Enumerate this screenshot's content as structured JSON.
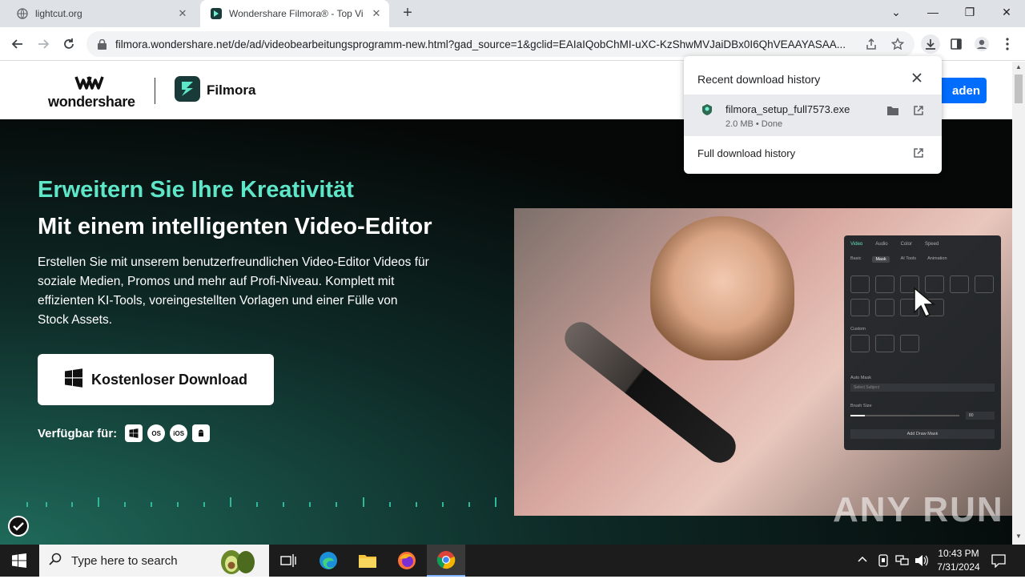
{
  "browser": {
    "tabs": [
      {
        "title": "lightcut.org",
        "close": "✕"
      },
      {
        "title": "Wondershare Filmora® - Top Vi",
        "close": "✕"
      }
    ],
    "new_tab": "+",
    "window_controls": {
      "dropdown": "⌄",
      "minimize": "—",
      "restore": "❐",
      "close": "✕"
    },
    "url": "filmora.wondershare.net/de/ad/videobearbeitungsprogramm-new.html?gad_source=1&gclid=EAIaIQobChMI-uXC-KzShwMVJaiDBx0I6QhVEAAYASAA...",
    "accent": "#1a73e8"
  },
  "site": {
    "brand": "wondershare",
    "product": "Filmora",
    "header_cta": "aden"
  },
  "hero": {
    "headline": "Erweitern Sie Ihre Kreativität",
    "subheadline": "Mit einem intelligenten Video-Editor",
    "description": "Erstellen Sie mit unserem benutzerfreundlichen Video-Editor Videos für soziale Medien, Promos und mehr auf Profi-Niveau. Komplett mit effizienten KI-Tools, voreingestellten Vorlagen und einer Fülle von Stock Assets.",
    "download_label": "Kostenloser Download",
    "available_label": "Verfügbar für:",
    "platforms": [
      "windows-icon",
      "macos-icon",
      "ios-icon",
      "android-icon"
    ],
    "macos_text": "OS",
    "ios_text": "iOS",
    "accent": "#5ee6c8"
  },
  "editor_panel": {
    "tabs": [
      "Video",
      "Audio",
      "Color",
      "Speed"
    ],
    "subtabs": [
      "Basic",
      "Mask",
      "AI Tools",
      "Animation"
    ],
    "custom_label": "Custom",
    "auto_mask_label": "Auto Mask",
    "select_subject": "Select Subject",
    "brush_size_label": "Brush Size",
    "brush_size_value": "80",
    "add_draw_mask": "Add Draw Mask"
  },
  "download_popup": {
    "title": "Recent download history",
    "file_name": "filmora_setup_full7573.exe",
    "file_meta": "2.0 MB • Done",
    "full_history": "Full download history"
  },
  "taskbar": {
    "search_placeholder": "Type here to search",
    "time": "10:43 PM",
    "date": "7/31/2024"
  },
  "watermark": "ANY RUN"
}
